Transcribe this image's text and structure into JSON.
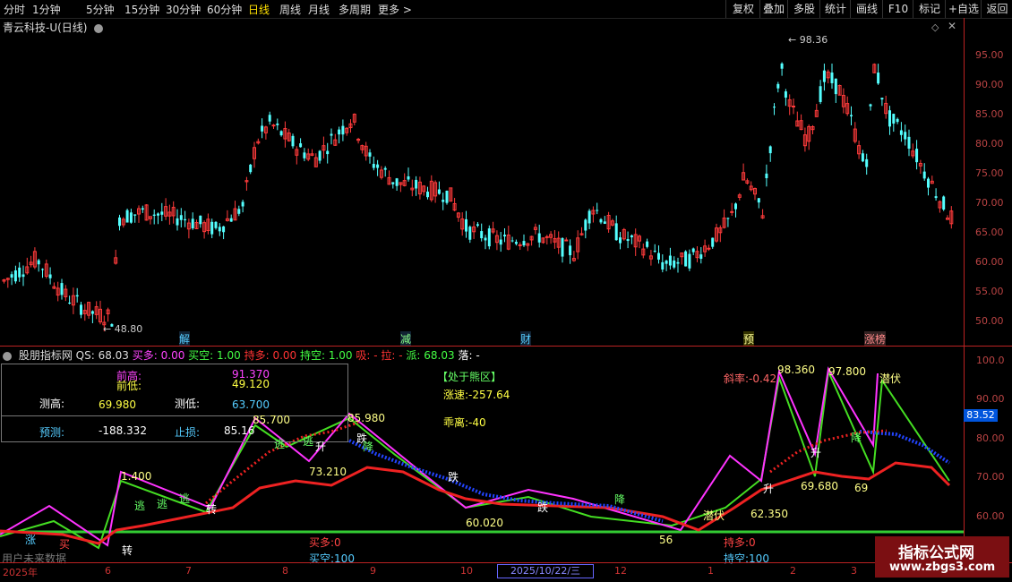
{
  "toolbar": {
    "periods": [
      "分时",
      "1分钟",
      "5分钟",
      "15分钟",
      "30分钟",
      "60分钟",
      "日线",
      "周线",
      "月线",
      "多周期",
      "更多 >"
    ],
    "active_period": "日线",
    "right_buttons": [
      "复权",
      "叠加",
      "多股",
      "统计",
      "画线",
      "F10",
      "标记",
      "+自选",
      "返回"
    ]
  },
  "stock": {
    "title": "青云科技-U(日线)",
    "high_label": "98.36",
    "low_label": "48.80",
    "price_axis": [
      "95.00",
      "90.00",
      "85.00",
      "80.00",
      "75.00",
      "70.00",
      "65.00",
      "60.00",
      "55.00",
      "50.00"
    ],
    "events": [
      "解",
      "减",
      "财",
      "预",
      "涨榜"
    ]
  },
  "indicator": {
    "name": "股朋指标网",
    "values": [
      {
        "text": "QS: 68.03",
        "color": "#dddddd"
      },
      {
        "text": "买多: 0.00",
        "color": "#ff44ff"
      },
      {
        "text": "买空: 1.00",
        "color": "#44ff44"
      },
      {
        "text": "持多: 0.00",
        "color": "#ff3333"
      },
      {
        "text": "持空: 1.00",
        "color": "#44ff44"
      },
      {
        "text": "吸: -",
        "color": "#ff3333"
      },
      {
        "text": "拉: -",
        "color": "#ff3333"
      },
      {
        "text": "派: 68.03",
        "color": "#44ff44"
      },
      {
        "text": "落: -",
        "color": "#ffffff"
      }
    ],
    "axis": [
      "100.0",
      "90.00",
      "80.00",
      "70.00",
      "60.00"
    ],
    "cursor_value": "83.52",
    "info": {
      "qian_gao_label": "前高:",
      "qian_gao": "91.370",
      "qian_di_label": "前低:",
      "qian_di": "49.120",
      "ce_gao_label": "测高:",
      "ce_gao": "69.980",
      "ce_di_label": "测低:",
      "ce_di": "63.700",
      "yuce_label": "预测:",
      "yuce": "-188.332",
      "zhisun_label": "止损:",
      "zhisun": "85.16"
    },
    "zone_title": "【处于熊区】",
    "zhangsu": "涨速:-257.64",
    "guli": "乖离:-40",
    "xielv": "斜率:-0.42",
    "mai_duo": "买多:0",
    "mai_kong": "买空:100",
    "chi_duo": "持多:0",
    "chi_kong": "持空:100",
    "peak_labels": [
      "1.400",
      "85.700",
      "85.980",
      "73.210",
      "60.020",
      "56",
      "62.350",
      "69.680",
      "69",
      "98.360",
      "97.800"
    ],
    "signal_labels": [
      "逃",
      "逃",
      "逃",
      "逃",
      "逃",
      "跌",
      "跌",
      "跌",
      "升",
      "升",
      "升",
      "降",
      "降",
      "降",
      "潜伏",
      "潜伏",
      "涨",
      "买",
      "转",
      "转"
    ],
    "hint": "用户未来数据"
  },
  "xaxis": {
    "labels": [
      "2025年",
      "6",
      "7",
      "8",
      "9",
      "10",
      "12",
      "1",
      "2",
      "3"
    ],
    "date": "2025/10/22/三"
  },
  "watermark": {
    "title": "指标公式网",
    "url": "www.zbgs3.com"
  },
  "colors": {
    "up": "#ff3b3b",
    "down": "#54ffff",
    "axis": "#b22222",
    "bg": "#000000"
  }
}
